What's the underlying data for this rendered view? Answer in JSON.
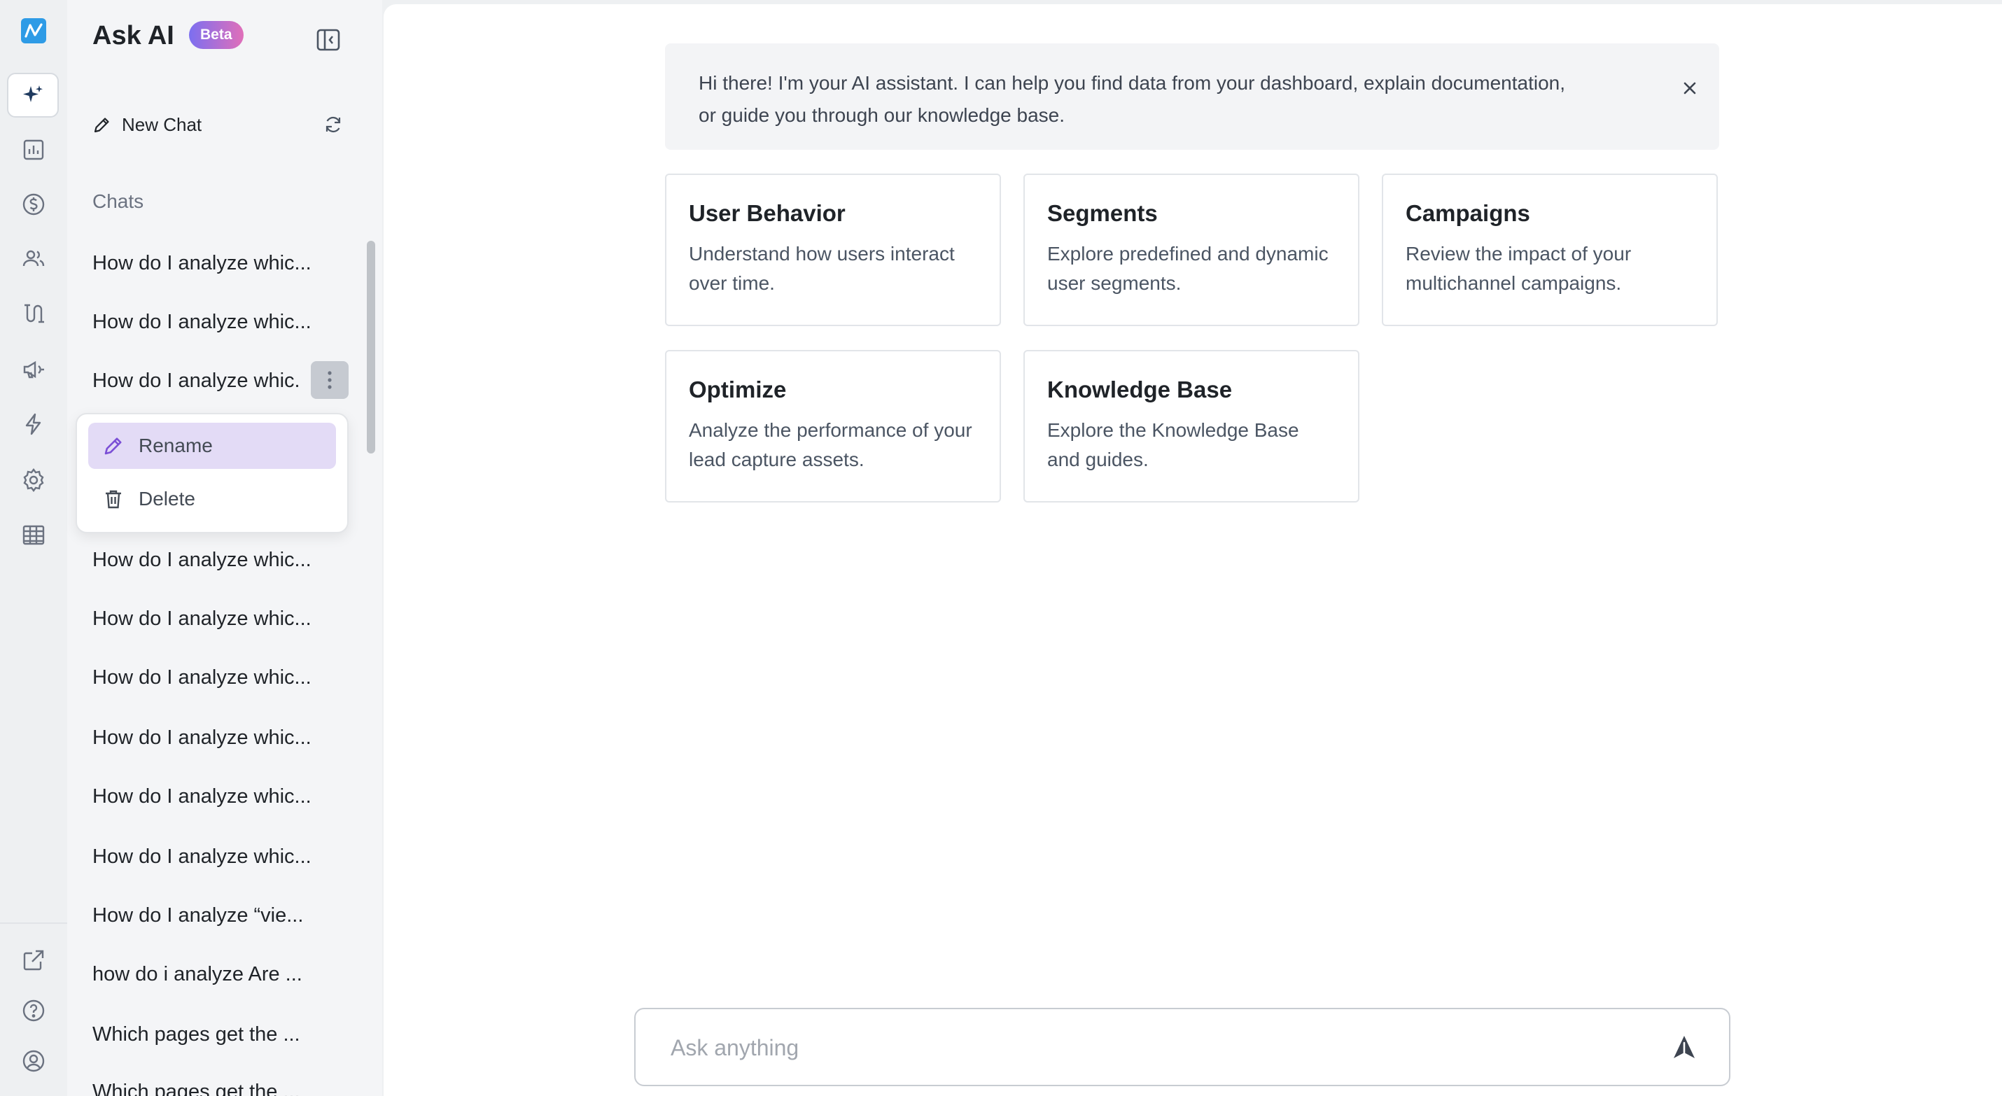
{
  "app": {
    "title": "Ask AI",
    "badge": "Beta"
  },
  "rail": {
    "top_icons": [
      "logo-icon",
      "sparkle-icon",
      "bar-chart-icon",
      "dollar-icon",
      "users-icon",
      "journey-icon",
      "megaphone-icon",
      "lightning-icon",
      "gear-icon",
      "building-icon"
    ],
    "bottom_icons": [
      "external-link-icon",
      "help-icon",
      "user-circle-icon"
    ],
    "active": "sparkle-icon",
    "brand_color": "#2e9be6"
  },
  "sidebar": {
    "new_chat_label": "New Chat",
    "section_label": "Chats",
    "chats": [
      "How do I analyze whic...",
      "How do I analyze whic...",
      "How do I analyze whic.",
      "How do I analyze whic...",
      "How do I analyze whic...",
      "How do I analyze whic...",
      "How do I analyze whic...",
      "How do I analyze whic...",
      "How do I analyze whic...",
      "How do I analyze “vie...",
      "how do i analyze Are ...",
      "Which pages get the ...",
      "Which pages get the ..."
    ],
    "context_menu": {
      "rename": "Rename",
      "delete": "Delete"
    }
  },
  "main": {
    "banner_text": "Hi there! I'm your AI assistant. I can help you find data from your dashboard, explain documentation, or guide you through our knowledge base.",
    "cards": [
      {
        "title": "User Behavior",
        "desc": "Understand how users interact over time."
      },
      {
        "title": "Segments",
        "desc": "Explore predefined and dynamic user segments."
      },
      {
        "title": "Campaigns",
        "desc": "Review the impact of your multichannel campaigns."
      },
      {
        "title": "Optimize",
        "desc": "Analyze the performance of your lead capture assets."
      },
      {
        "title": "Knowledge Base",
        "desc": "Explore the Knowledge Base and guides."
      }
    ],
    "input_placeholder": "Ask anything"
  },
  "colors": {
    "accent": "#7b4fd6",
    "menu_highlight": "#e3dbf6"
  }
}
